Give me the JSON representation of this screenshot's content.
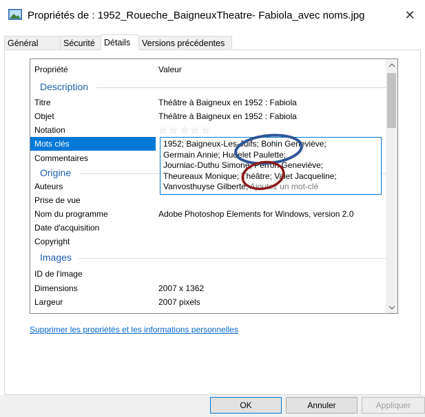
{
  "window": {
    "title": "Propriétés de : 1952_Roueche_BaigneuxTheatre- Fabiola_avec noms.jpg",
    "close_glyph": "✕"
  },
  "tabs": [
    {
      "label": "Général",
      "active": false
    },
    {
      "label": "Sécurité",
      "active": false
    },
    {
      "label": "Détails",
      "active": true
    },
    {
      "label": "Versions précédentes",
      "active": false
    }
  ],
  "list": {
    "headers": {
      "property": "Propriété",
      "value": "Valeur"
    },
    "sections": {
      "description": "Description",
      "origin": "Origine",
      "images": "Images"
    },
    "rows": {
      "titre": {
        "k": "Titre",
        "v": "Théâtre à Baigneux en 1952 : Fabiola"
      },
      "objet": {
        "k": "Objet",
        "v": "Théâtre à Baigneux en 1952 : Fabiola"
      },
      "notation": {
        "k": "Notation",
        "v": "☆☆☆☆☆"
      },
      "mots_cles": {
        "k": "Mots clés"
      },
      "commentaires": {
        "k": "Commentaires"
      },
      "auteurs": {
        "k": "Auteurs"
      },
      "prise_de_vue": {
        "k": "Prise de vue"
      },
      "programme": {
        "k": "Nom du programme",
        "v": "Adobe Photoshop Elements for Windows, version 2.0"
      },
      "acquisition": {
        "k": "Date d'acquisition"
      },
      "copyright": {
        "k": "Copyright"
      },
      "id_image": {
        "k": "ID de l'image"
      },
      "dimensions": {
        "k": "Dimensions",
        "v": "2007 x 1362"
      },
      "largeur": {
        "k": "Largeur",
        "v": "2007 pixels"
      }
    },
    "keywords_editor": {
      "lines": [
        "1952; Baigneux-Les-Juifs; Bohin Geneviève;",
        "Germain Annie; Hudelet Paulette;",
        "Journiac-Duthu Simone; Perron Geneviève;",
        "Theureaux Monique; Théâtre; Valet Jacqueline;"
      ],
      "last_line": "Vanvosthuyse Gilberte;",
      "placeholder": "Ajoutez un mot-clé"
    }
  },
  "link": "Supprimer les propriétés et les informations personnelles",
  "buttons": {
    "ok": "OK",
    "cancel": "Annuler",
    "apply": "Appliquer"
  },
  "annotations": {
    "blue_circle_color": "#2f5597",
    "red_circle_color": "#8b1a1a"
  }
}
